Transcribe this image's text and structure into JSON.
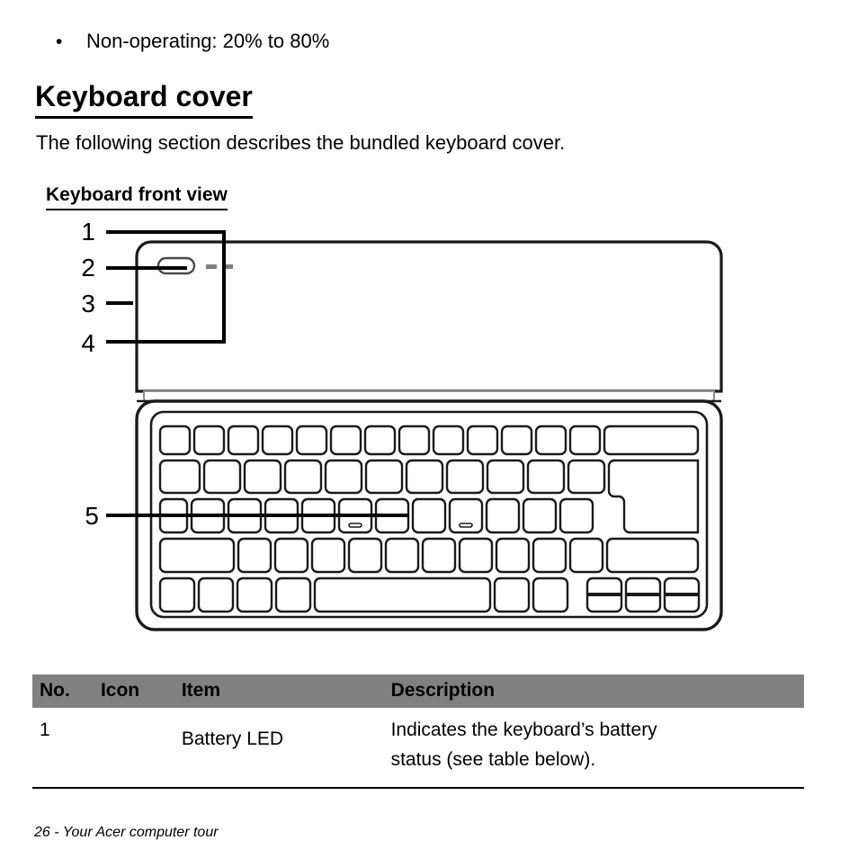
{
  "bullet": {
    "marker": "•",
    "text": "Non-operating: 20% to 80%"
  },
  "headings": {
    "section_title": "Keyboard cover",
    "intro_paragraph": "The following section describes the bundled keyboard cover.",
    "figure_title": "Keyboard front view"
  },
  "figure": {
    "name": "keyboard-front-view-diagram",
    "callouts": [
      {
        "number": "1",
        "target": "top-edge-of-cover"
      },
      {
        "number": "2",
        "target": "speaker-slot"
      },
      {
        "number": "3",
        "target": "left-edge-of-cover"
      },
      {
        "number": "4",
        "target": "battery-led"
      },
      {
        "number": "5",
        "target": "keyboard-keys"
      }
    ],
    "colors": {
      "outline": "#1a1a1a",
      "led_gray": "#808080",
      "hinge_gray": "#8c8c8c"
    }
  },
  "table": {
    "name": "keyboard-components-table",
    "headers": [
      "No.",
      "Icon",
      "Item",
      "Description"
    ],
    "rows": [
      {
        "no": "1",
        "icon": "",
        "item": "Battery LED",
        "description_line1": "Indicates the keyboard’s battery",
        "description_line2": "status (see table below)."
      }
    ]
  },
  "footer": {
    "text": "26 - Your Acer computer tour"
  }
}
